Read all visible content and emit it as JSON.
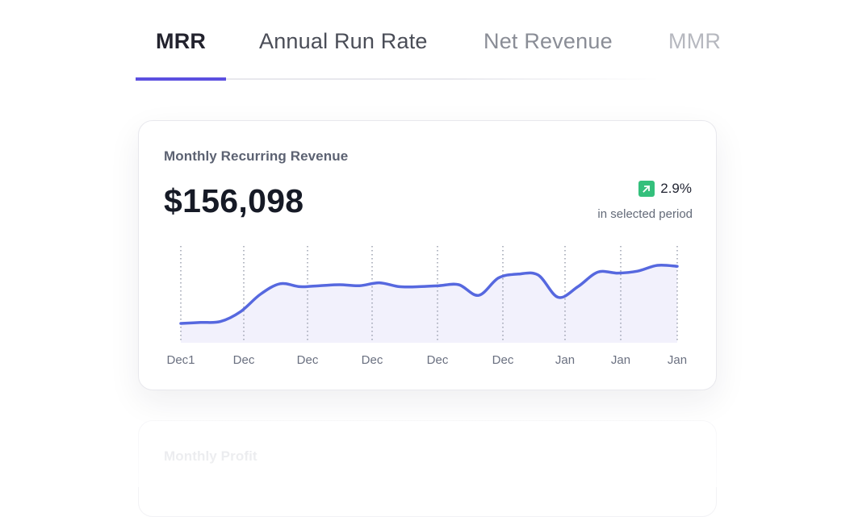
{
  "tabs": [
    {
      "label": "MRR",
      "color": "#23232e",
      "active": true
    },
    {
      "label": "Annual Run Rate",
      "color": "#4a4d57",
      "active": false
    },
    {
      "label": "Net Revenue",
      "color": "#8a8d96",
      "active": false
    },
    {
      "label": "MMR",
      "color": "#b6b8bf",
      "active": false
    }
  ],
  "accent_color": "#5b4fe0",
  "card": {
    "title": "Monthly Recurring Revenue",
    "value": "$156,098",
    "change": "2.9%",
    "change_icon": "arrow-up-right-icon",
    "change_color": "#34c07c",
    "period": "in selected period"
  },
  "chart_data": {
    "type": "area",
    "x_tick_labels": [
      "Dec1",
      "Dec",
      "Dec",
      "Dec",
      "Dec",
      "Dec",
      "Jan",
      "Jan",
      "Jan"
    ],
    "series": [
      {
        "color": "#5668df",
        "values": [
          20,
          21,
          22,
          32,
          50,
          61,
          58,
          59,
          60,
          59,
          62,
          58,
          58,
          59,
          60,
          49,
          67,
          71,
          70,
          47,
          58,
          73,
          72,
          74,
          80,
          79
        ]
      }
    ],
    "ylim": [
      0,
      100
    ],
    "grid": "vertical dotted lines at each tick",
    "legend": "none"
  },
  "next_card": {
    "title": "Monthly Profit"
  }
}
